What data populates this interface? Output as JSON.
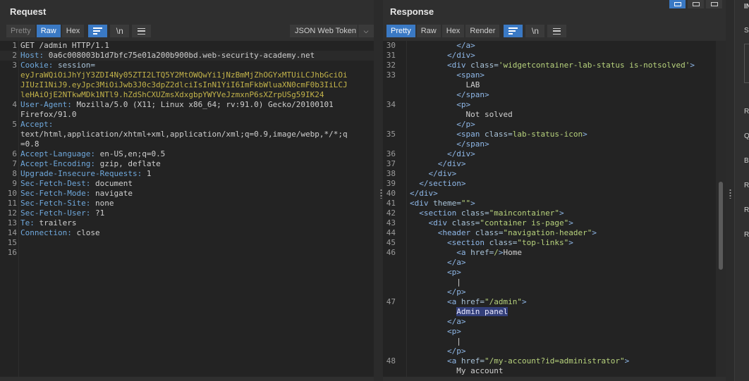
{
  "request": {
    "title": "Request",
    "tabs": [
      "Pretty",
      "Raw",
      "Hex"
    ],
    "active_tab": "Raw",
    "dropdown_label": "JSON Web Token",
    "lines": [
      {
        "n": "1",
        "parts": [
          {
            "c": "s",
            "t": "GET /admin HTTP/1.1"
          }
        ]
      },
      {
        "n": "2",
        "parts": [
          {
            "c": "k",
            "t": "Host: "
          },
          {
            "c": "s",
            "t": "0a6c008003b1d7bfc75e01a200b900bd.web-security-academy.net"
          }
        ]
      },
      {
        "n": "3",
        "parts": [
          {
            "c": "k",
            "t": "Cookie: "
          },
          {
            "c": "attr",
            "t": "session="
          }
        ]
      },
      {
        "n": "",
        "parts": [
          {
            "c": "v",
            "t": "eyJraWQiOiJhYjY3ZDI4Ny05ZTI2LTQ5Y2MtOWQwYi1jNzBmMjZhOGYxMTUiLCJhbGciOi"
          }
        ]
      },
      {
        "n": "",
        "parts": [
          {
            "c": "v",
            "t": "JIUzI1NiJ9.eyJpc3MiOiJwb3J0c3dpZ2dlciIsInN1YiI6ImFkbWluaXN0cmF0b3IiLCJ"
          }
        ]
      },
      {
        "n": "",
        "parts": [
          {
            "c": "v",
            "t": "leHAiOjE2NTkwMDk1NTl9.hZdShCXUZmsXdxgbpYWYVeJzmxnP6sXZrpUSg59IK24"
          }
        ]
      },
      {
        "n": "4",
        "parts": [
          {
            "c": "k",
            "t": "User-Agent: "
          },
          {
            "c": "s",
            "t": "Mozilla/5.0 (X11; Linux x86_64; rv:91.0) Gecko/20100101"
          }
        ]
      },
      {
        "n": "",
        "parts": [
          {
            "c": "s",
            "t": "Firefox/91.0"
          }
        ]
      },
      {
        "n": "5",
        "parts": [
          {
            "c": "k",
            "t": "Accept: "
          }
        ]
      },
      {
        "n": "",
        "parts": [
          {
            "c": "s",
            "t": "text/html,application/xhtml+xml,application/xml;q=0.9,image/webp,*/*;q"
          }
        ]
      },
      {
        "n": "",
        "parts": [
          {
            "c": "s",
            "t": "=0.8"
          }
        ]
      },
      {
        "n": "6",
        "parts": [
          {
            "c": "k",
            "t": "Accept-Language: "
          },
          {
            "c": "s",
            "t": "en-US,en;q=0.5"
          }
        ]
      },
      {
        "n": "7",
        "parts": [
          {
            "c": "k",
            "t": "Accept-Encoding: "
          },
          {
            "c": "s",
            "t": "gzip, deflate"
          }
        ]
      },
      {
        "n": "8",
        "parts": [
          {
            "c": "k",
            "t": "Upgrade-Insecure-Requests: "
          },
          {
            "c": "s",
            "t": "1"
          }
        ]
      },
      {
        "n": "9",
        "parts": [
          {
            "c": "k",
            "t": "Sec-Fetch-Dest: "
          },
          {
            "c": "s",
            "t": "document"
          }
        ]
      },
      {
        "n": "10",
        "parts": [
          {
            "c": "k",
            "t": "Sec-Fetch-Mode: "
          },
          {
            "c": "s",
            "t": "navigate"
          }
        ]
      },
      {
        "n": "11",
        "parts": [
          {
            "c": "k",
            "t": "Sec-Fetch-Site: "
          },
          {
            "c": "s",
            "t": "none"
          }
        ]
      },
      {
        "n": "12",
        "parts": [
          {
            "c": "k",
            "t": "Sec-Fetch-User: "
          },
          {
            "c": "s",
            "t": "?1"
          }
        ]
      },
      {
        "n": "13",
        "parts": [
          {
            "c": "k",
            "t": "Te: "
          },
          {
            "c": "s",
            "t": "trailers"
          }
        ]
      },
      {
        "n": "14",
        "parts": [
          {
            "c": "k",
            "t": "Connection: "
          },
          {
            "c": "s",
            "t": "close"
          }
        ]
      },
      {
        "n": "15",
        "parts": []
      },
      {
        "n": "16",
        "parts": []
      }
    ]
  },
  "response": {
    "title": "Response",
    "tabs": [
      "Pretty",
      "Raw",
      "Hex",
      "Render"
    ],
    "active_tab": "Pretty",
    "lines": [
      {
        "n": "30",
        "parts": [
          {
            "c": "s",
            "t": "          "
          },
          {
            "c": "tag",
            "t": "</a>"
          }
        ]
      },
      {
        "n": "31",
        "parts": [
          {
            "c": "s",
            "t": "        "
          },
          {
            "c": "tag",
            "t": "</div>"
          }
        ]
      },
      {
        "n": "32",
        "parts": [
          {
            "c": "s",
            "t": "        "
          },
          {
            "c": "tag",
            "t": "<div "
          },
          {
            "c": "attr",
            "t": "class="
          },
          {
            "c": "str",
            "t": "'widgetcontainer-lab-status is-notsolved'"
          },
          {
            "c": "tag",
            "t": ">"
          }
        ]
      },
      {
        "n": "33",
        "parts": [
          {
            "c": "s",
            "t": "          "
          },
          {
            "c": "tag",
            "t": "<span>"
          }
        ]
      },
      {
        "n": "",
        "parts": [
          {
            "c": "s",
            "t": "            LAB"
          }
        ]
      },
      {
        "n": "",
        "parts": [
          {
            "c": "s",
            "t": "          "
          },
          {
            "c": "tag",
            "t": "</span>"
          }
        ]
      },
      {
        "n": "34",
        "parts": [
          {
            "c": "s",
            "t": "          "
          },
          {
            "c": "tag",
            "t": "<p>"
          }
        ]
      },
      {
        "n": "",
        "parts": [
          {
            "c": "s",
            "t": "            Not solved"
          }
        ]
      },
      {
        "n": "",
        "parts": [
          {
            "c": "s",
            "t": "          "
          },
          {
            "c": "tag",
            "t": "</p>"
          }
        ]
      },
      {
        "n": "35",
        "parts": [
          {
            "c": "s",
            "t": "          "
          },
          {
            "c": "tag",
            "t": "<span "
          },
          {
            "c": "attr",
            "t": "class="
          },
          {
            "c": "str",
            "t": "lab-status-icon"
          },
          {
            "c": "tag",
            "t": ">"
          }
        ]
      },
      {
        "n": "",
        "parts": [
          {
            "c": "s",
            "t": "          "
          },
          {
            "c": "tag",
            "t": "</span>"
          }
        ]
      },
      {
        "n": "36",
        "parts": [
          {
            "c": "s",
            "t": "        "
          },
          {
            "c": "tag",
            "t": "</div>"
          }
        ]
      },
      {
        "n": "37",
        "parts": [
          {
            "c": "s",
            "t": "      "
          },
          {
            "c": "tag",
            "t": "</div>"
          }
        ]
      },
      {
        "n": "38",
        "parts": [
          {
            "c": "s",
            "t": "    "
          },
          {
            "c": "tag",
            "t": "</div>"
          }
        ]
      },
      {
        "n": "39",
        "parts": [
          {
            "c": "s",
            "t": "  "
          },
          {
            "c": "tag",
            "t": "</section>"
          }
        ]
      },
      {
        "n": "40",
        "parts": [
          {
            "c": "tag",
            "t": "</div>"
          }
        ]
      },
      {
        "n": "41",
        "parts": [
          {
            "c": "tag",
            "t": "<div "
          },
          {
            "c": "attr",
            "t": "theme="
          },
          {
            "c": "str",
            "t": "\"\""
          },
          {
            "c": "tag",
            "t": ">"
          }
        ]
      },
      {
        "n": "42",
        "parts": [
          {
            "c": "s",
            "t": "  "
          },
          {
            "c": "tag",
            "t": "<section "
          },
          {
            "c": "attr",
            "t": "class="
          },
          {
            "c": "str",
            "t": "\"maincontainer\""
          },
          {
            "c": "tag",
            "t": ">"
          }
        ]
      },
      {
        "n": "43",
        "parts": [
          {
            "c": "s",
            "t": "    "
          },
          {
            "c": "tag",
            "t": "<div "
          },
          {
            "c": "attr",
            "t": "class="
          },
          {
            "c": "str",
            "t": "\"container is-page\""
          },
          {
            "c": "tag",
            "t": ">"
          }
        ]
      },
      {
        "n": "44",
        "parts": [
          {
            "c": "s",
            "t": "      "
          },
          {
            "c": "tag",
            "t": "<header "
          },
          {
            "c": "attr",
            "t": "class="
          },
          {
            "c": "str",
            "t": "\"navigation-header\""
          },
          {
            "c": "tag",
            "t": ">"
          }
        ]
      },
      {
        "n": "45",
        "parts": [
          {
            "c": "s",
            "t": "        "
          },
          {
            "c": "tag",
            "t": "<section "
          },
          {
            "c": "attr",
            "t": "class="
          },
          {
            "c": "str",
            "t": "\"top-links\""
          },
          {
            "c": "tag",
            "t": ">"
          }
        ]
      },
      {
        "n": "46",
        "parts": [
          {
            "c": "s",
            "t": "          "
          },
          {
            "c": "tag",
            "t": "<a "
          },
          {
            "c": "attr",
            "t": "href="
          },
          {
            "c": "str",
            "t": "/"
          },
          {
            "c": "tag",
            "t": ">"
          },
          {
            "c": "s",
            "t": "Home"
          }
        ]
      },
      {
        "n": "",
        "parts": [
          {
            "c": "s",
            "t": "        "
          },
          {
            "c": "tag",
            "t": "</a>"
          }
        ]
      },
      {
        "n": "",
        "parts": [
          {
            "c": "s",
            "t": "        "
          },
          {
            "c": "tag",
            "t": "<p>"
          }
        ]
      },
      {
        "n": "",
        "parts": [
          {
            "c": "s",
            "t": "          |"
          }
        ]
      },
      {
        "n": "",
        "parts": [
          {
            "c": "s",
            "t": "        "
          },
          {
            "c": "tag",
            "t": "</p>"
          }
        ]
      },
      {
        "n": "47",
        "parts": [
          {
            "c": "s",
            "t": "        "
          },
          {
            "c": "tag",
            "t": "<a "
          },
          {
            "c": "attr",
            "t": "href="
          },
          {
            "c": "str",
            "t": "\"/admin\""
          },
          {
            "c": "tag",
            "t": ">"
          }
        ]
      },
      {
        "n": "",
        "parts": [
          {
            "c": "s",
            "t": "          "
          },
          {
            "c": "hl",
            "t": "Admin panel"
          }
        ]
      },
      {
        "n": "",
        "parts": [
          {
            "c": "s",
            "t": "        "
          },
          {
            "c": "tag",
            "t": "</a>"
          }
        ]
      },
      {
        "n": "",
        "parts": [
          {
            "c": "s",
            "t": "        "
          },
          {
            "c": "tag",
            "t": "<p>"
          }
        ]
      },
      {
        "n": "",
        "parts": [
          {
            "c": "s",
            "t": "          |"
          }
        ]
      },
      {
        "n": "",
        "parts": [
          {
            "c": "s",
            "t": "        "
          },
          {
            "c": "tag",
            "t": "</p>"
          }
        ]
      },
      {
        "n": "48",
        "parts": [
          {
            "c": "s",
            "t": "        "
          },
          {
            "c": "tag",
            "t": "<a "
          },
          {
            "c": "attr",
            "t": "href="
          },
          {
            "c": "str",
            "t": "\"/my-account?id=administrator\""
          },
          {
            "c": "tag",
            "t": ">"
          }
        ]
      },
      {
        "n": "",
        "parts": [
          {
            "c": "s",
            "t": "          My account"
          }
        ]
      }
    ]
  },
  "icons": {
    "wrap": "word-wrap-icon",
    "newline": "\\n",
    "menu": "hamburger-menu-icon",
    "chevron": "chevron-down-icon"
  },
  "right_panel_initials": [
    "IN",
    "Se",
    "R",
    "Q",
    "B",
    "R",
    "R",
    "R"
  ],
  "colors": {
    "accent": "#3a79c4",
    "header_key": "#6fa8dc",
    "cookie_value": "#c3b34a",
    "highlight": "#333f7a"
  }
}
